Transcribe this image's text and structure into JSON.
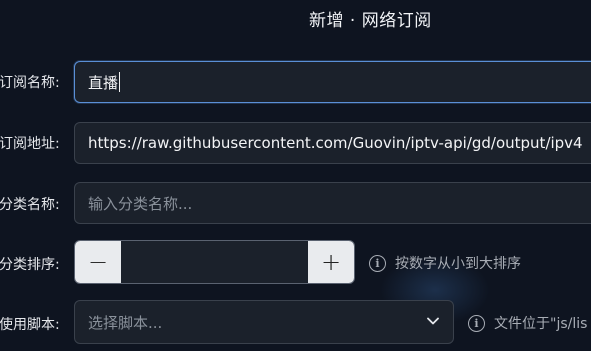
{
  "dialog": {
    "title": "新增 · 网络订阅"
  },
  "form": {
    "name": {
      "label": "订阅名称:",
      "value": "直播"
    },
    "url": {
      "label": "订阅地址:",
      "value": "https://raw.githubusercontent.com/Guovin/iptv-api/gd/output/ipv4"
    },
    "category": {
      "label": "分类名称:",
      "placeholder": "输入分类名称..."
    },
    "order": {
      "label": "分类排序:",
      "minus": "−",
      "plus": "+",
      "value": "",
      "hint": "按数字从小到大排序"
    },
    "script": {
      "label": "使用脚本:",
      "placeholder": "选择脚本...",
      "hint": "文件位于\"js/lis"
    }
  },
  "icons": {
    "info": "info-icon",
    "dropdown": "chevron-down-icon"
  },
  "colors": {
    "background": "#0e1420",
    "focus_border": "#5a8fd6",
    "field_bg": "#1b212b"
  }
}
